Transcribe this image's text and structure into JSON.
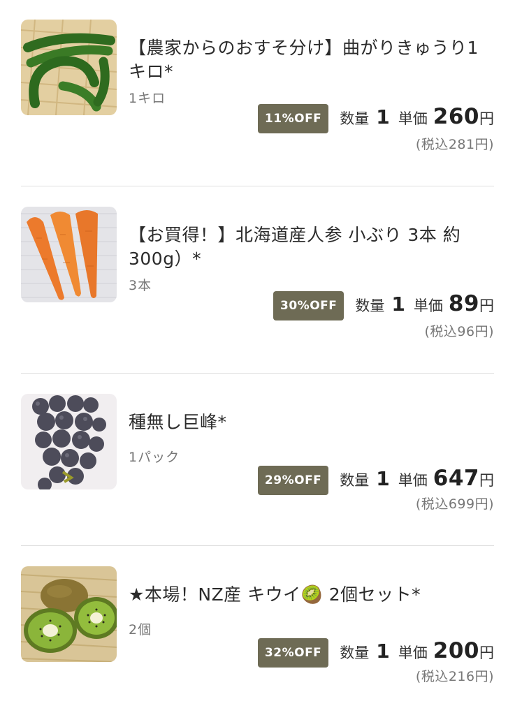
{
  "items": [
    {
      "title": "【農家からのおすそ分け】曲がりきゅうり1キロ*",
      "unit": "1キロ",
      "badge": "11%OFF",
      "qty_label": "数量",
      "qty": "1",
      "price_label": "単価",
      "price": "260",
      "yen": "円",
      "tax": "(税込281円)",
      "image": "cucumber-image"
    },
    {
      "title": "【お買得！】北海道産人参 小ぶり 3本 約300g）*",
      "unit": "3本",
      "badge": "30%OFF",
      "qty_label": "数量",
      "qty": "1",
      "price_label": "単価",
      "price": "89",
      "yen": "円",
      "tax": "(税込96円)",
      "image": "carrot-image"
    },
    {
      "title": "種無し巨峰*",
      "unit": "1パック",
      "badge": "29%OFF",
      "qty_label": "数量",
      "qty": "1",
      "price_label": "単価",
      "price": "647",
      "yen": "円",
      "tax": "(税込699円)",
      "image": "grape-image"
    },
    {
      "title": "★本場！NZ産 キウイ🥝 2個セット*",
      "unit": "2個",
      "badge": "32%OFF",
      "qty_label": "数量",
      "qty": "1",
      "price_label": "単価",
      "price": "200",
      "yen": "円",
      "tax": "(税込216円)",
      "image": "kiwi-image"
    }
  ],
  "colors": {
    "badge": "#6e6b55",
    "divider": "#dedede"
  }
}
